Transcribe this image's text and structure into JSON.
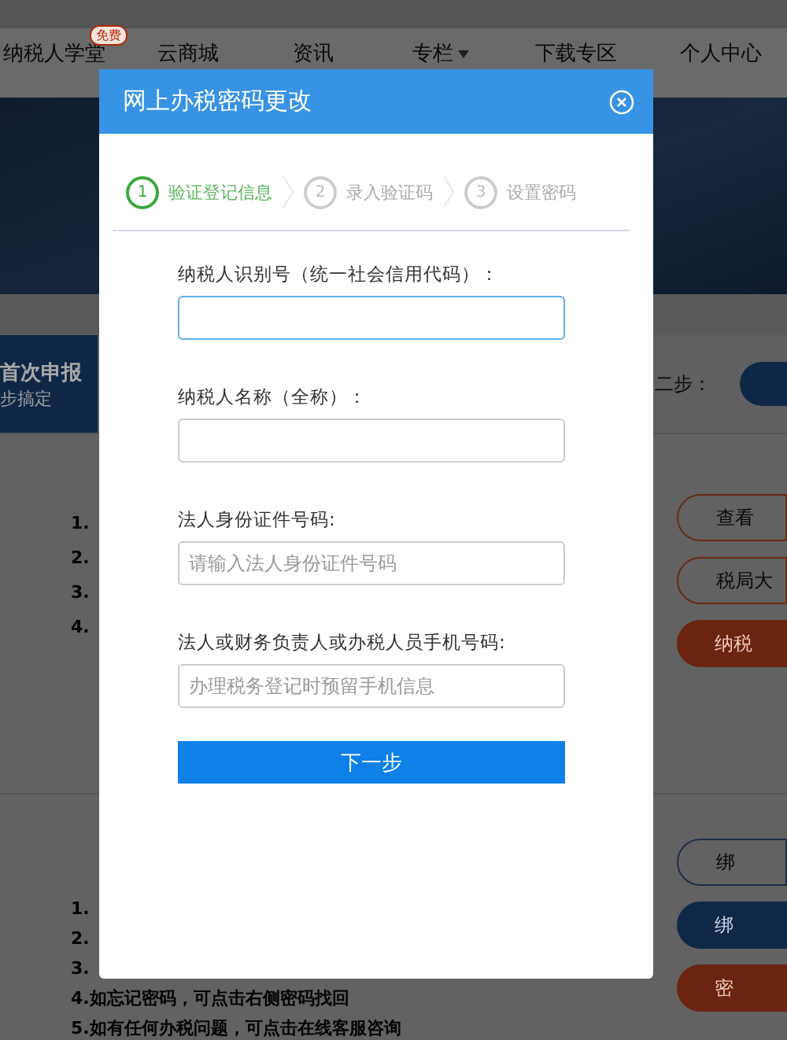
{
  "page": {
    "nav": [
      {
        "label": "纳税人学堂",
        "badge": "免费",
        "dropdown": false
      },
      {
        "label": "云商城",
        "dropdown": false
      },
      {
        "label": "资讯",
        "dropdown": false
      },
      {
        "label": "专栏",
        "dropdown": true
      },
      {
        "label": "下载专区",
        "dropdown": false
      },
      {
        "label": "个人中心",
        "dropdown": false
      }
    ],
    "promo": {
      "title": "首次申报",
      "subtitle": "步搞定",
      "step_label": "二步："
    },
    "panels": [
      {
        "items": [
          "1.",
          "2.",
          "3.",
          "4."
        ],
        "buttons": [
          {
            "label": "查看",
            "kind": "outline"
          },
          {
            "label": "税局大",
            "kind": "outline"
          },
          {
            "label": "纳税",
            "kind": "orange"
          }
        ]
      },
      {
        "items": [
          "1.",
          "2.",
          "3.",
          "4.如忘记密码，可点击右侧密码找回",
          "5.如有任何办税问题，可点击在线客服咨询"
        ],
        "buttons": [
          {
            "label": "绑",
            "kind": "navy-outline"
          },
          {
            "label": "绑",
            "kind": "navy"
          },
          {
            "label": "密",
            "kind": "orange"
          }
        ]
      }
    ]
  },
  "modal": {
    "title": "网上办税密码更改",
    "steps": [
      {
        "number": "1",
        "label": "验证登记信息",
        "selected": true
      },
      {
        "number": "2",
        "label": "录入验证码",
        "selected": false
      },
      {
        "number": "3",
        "label": "设置密码",
        "selected": false
      }
    ],
    "fields": [
      {
        "label": "纳税人识别号（统一社会信用代码）：",
        "focused": true
      },
      {
        "label": "纳税人名称（全称）：",
        "focused": false
      },
      {
        "label": "法人身份证件号码:",
        "placeholder": "请输入法人身份证件号码",
        "focused": false
      },
      {
        "label": "法人或财务负责人或办税人员手机号码:",
        "placeholder": "办理税务登记时预留手机信息",
        "focused": false
      }
    ],
    "submit": "下一步"
  }
}
